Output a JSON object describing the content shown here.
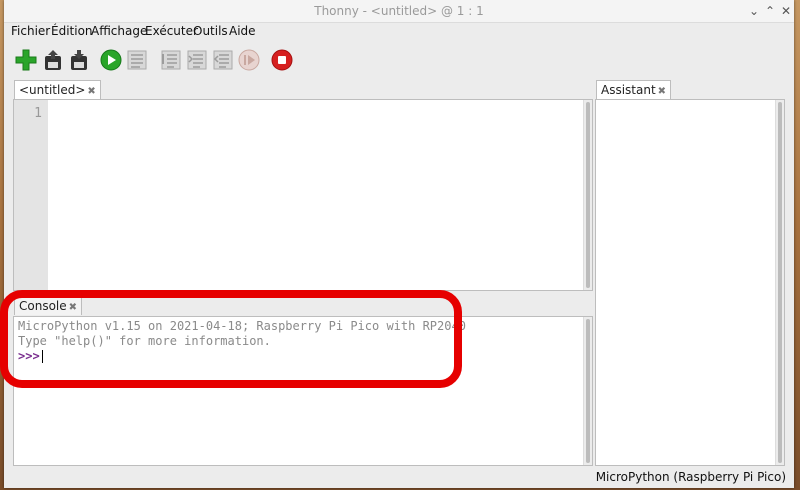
{
  "window": {
    "title": "Thonny  -  <untitled>  @  1 : 1"
  },
  "menu": [
    "Fichier",
    "Édition",
    "Affichage",
    "Exécuter",
    "Outils",
    "Aide"
  ],
  "toolbar": [
    "new-file-icon",
    "open-file-icon",
    "save-file-icon",
    "run-icon",
    "debug-icon",
    "step-over-icon",
    "step-into-icon",
    "step-out-icon",
    "resume-icon",
    "stop-icon"
  ],
  "editor": {
    "tab_label": "<untitled>",
    "line_number": "1"
  },
  "console": {
    "tab_label": "Console",
    "lines": [
      "MicroPython v1.15 on 2021-04-18; Raspberry Pi Pico with RP2040",
      "Type \"help()\" for more information."
    ],
    "prompt": ">>>"
  },
  "assistant": {
    "tab_label": "Assistant"
  },
  "status": {
    "interpreter": "MicroPython (Raspberry Pi Pico)"
  },
  "colors": {
    "highlight": "#e60000",
    "run_green": "#2aa52a",
    "stop_red": "#d62020"
  }
}
